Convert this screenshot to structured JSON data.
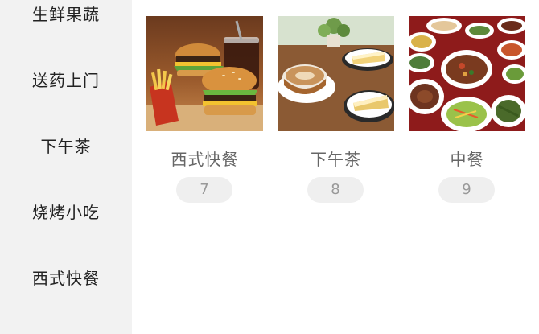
{
  "sidebar": {
    "items": [
      {
        "label": "生鲜果蔬"
      },
      {
        "label": "送药上门"
      },
      {
        "label": "下午茶"
      },
      {
        "label": "烧烤小吃"
      },
      {
        "label": "西式快餐"
      }
    ]
  },
  "cards": [
    {
      "title": "西式快餐",
      "count": "7",
      "image": "burger-fries-cola-photo"
    },
    {
      "title": "下午茶",
      "count": "8",
      "image": "coffee-cake-photo"
    },
    {
      "title": "中餐",
      "count": "9",
      "image": "chinese-dishes-photo"
    }
  ],
  "colors": {
    "sidebar_bg": "#f2f2f2",
    "badge_bg": "#efefef",
    "title_text": "#666666"
  }
}
